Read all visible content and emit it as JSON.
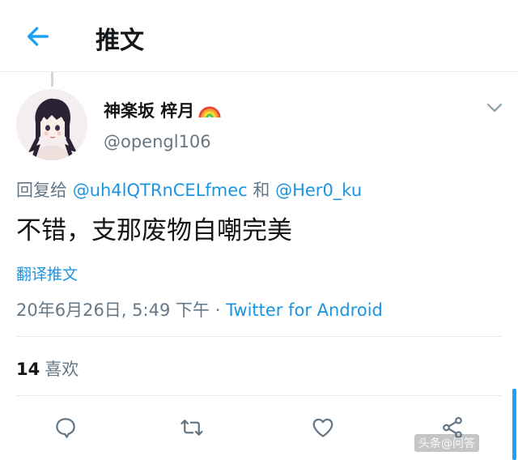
{
  "header": {
    "title": "推文"
  },
  "tweet": {
    "author_name": "神楽坂 梓月",
    "author_handle": "@opengl106",
    "reply_prefix": "回复给",
    "mention_1": "@uh4lQTRnCELfmec",
    "reply_and": "和",
    "mention_2": "@Her0_ku",
    "text": "不错，支那废物自嘲完美",
    "translate_label": "翻译推文",
    "timestamp": "20年6月26日, 5:49 下午",
    "source_sep": "·",
    "source": "Twitter for Android"
  },
  "stats": {
    "likes_count": "14",
    "likes_label": "喜欢"
  },
  "watermark": {
    "text": "头条@问答"
  },
  "colors": {
    "accent": "#1b95e0",
    "secondary": "#657786",
    "divider": "#e6ecf0"
  },
  "icons": [
    "back-arrow-icon",
    "rainbow-emoji-icon",
    "chevron-down-icon",
    "reply-icon",
    "retweet-icon",
    "like-icon",
    "share-icon"
  ]
}
